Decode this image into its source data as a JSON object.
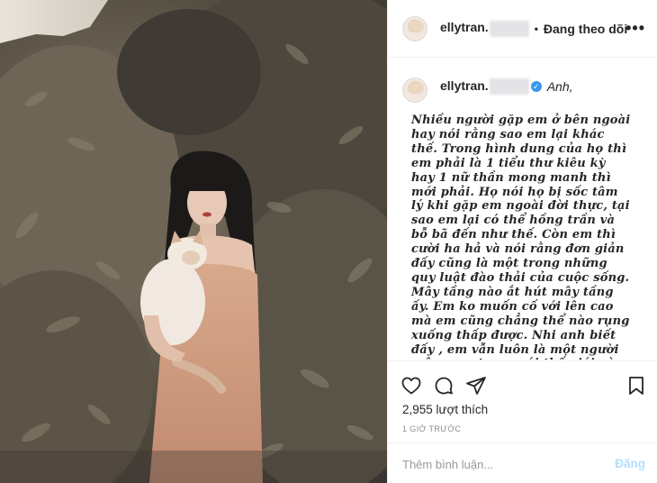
{
  "post": {
    "username": "ellytran.",
    "follow_status": "Đang theo dõi",
    "separator": "•",
    "more_label": "•••"
  },
  "caption": {
    "username": "ellytran.",
    "verified_mark": "✓",
    "prefix": "Anh,",
    "text": "Nhiều người gặp em ở bên ngoài hay nói rằng sao em lại khác thế. Trong hình dung của họ thì em phải là 1 tiểu thư kiêu kỳ hay 1 nữ thần mong manh thì mới phải. Họ nói họ bị sốc tâm lý khi gặp em ngoài đời thực, tại sao em lại có thể hồng trần và bỗ bã đến như thế. Còn em thì cười ha hả và nói rằng đơn giản đấy cũng là một trong những quy luật đào thải của cuộc sống. Mây tầng nào ắt hút mây tầng ấy. Em ko muốn cố với lên cao mà em cũng chẳng thể nào rụng xuống thấp được. Nhi anh biết đấy , em vẫn luôn là một người mộng mơ trong cái thế giới này mà"
  },
  "stats": {
    "likes": "2,955 lượt thích",
    "time": "1 GIỜ TRƯỚC"
  },
  "comment_box": {
    "placeholder": "Thêm bình luận...",
    "post_label": "Đăng",
    "post_color": "#b2dffc"
  },
  "icons": [
    "heart-icon",
    "comment-icon",
    "share-icon",
    "bookmark-icon"
  ]
}
